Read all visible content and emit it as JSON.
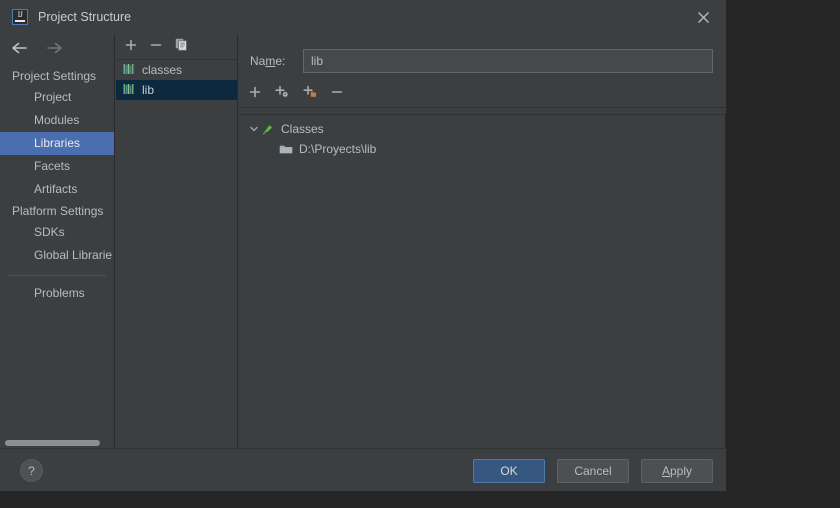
{
  "window": {
    "title": "Project Structure",
    "app_icon": "intellij-idea-logo",
    "close_icon": "close-icon"
  },
  "navigation": {
    "back_icon": "arrow-left-icon",
    "forward_icon": "arrow-right-icon"
  },
  "sidebar": {
    "groups": [
      {
        "header": "Project Settings",
        "items": [
          {
            "label": "Project",
            "selected": false
          },
          {
            "label": "Modules",
            "selected": false
          },
          {
            "label": "Libraries",
            "selected": true
          },
          {
            "label": "Facets",
            "selected": false
          },
          {
            "label": "Artifacts",
            "selected": false
          }
        ]
      },
      {
        "header": "Platform Settings",
        "items": [
          {
            "label": "SDKs",
            "selected": false
          },
          {
            "label": "Global Librarie",
            "selected": false
          }
        ]
      }
    ],
    "extra": [
      {
        "label": "Problems",
        "selected": false
      }
    ]
  },
  "library_panel": {
    "toolbar": [
      {
        "name": "add-library-button",
        "glyph": "+"
      },
      {
        "name": "remove-library-button",
        "glyph": "−"
      },
      {
        "name": "copy-library-button",
        "glyph": "copy-icon"
      }
    ],
    "items": [
      {
        "label": "classes",
        "icon": "library-icon",
        "selected": false
      },
      {
        "label": "lib",
        "icon": "library-icon",
        "selected": true
      }
    ]
  },
  "detail": {
    "name_label_pre": "Na",
    "name_label_mnemonic": "m",
    "name_label_post": "e:",
    "name_value": "lib",
    "name_placeholder": "",
    "toolbar": [
      {
        "name": "add-root-button",
        "glyph": "+"
      },
      {
        "name": "add-from-maven-button",
        "glyph": "+◌"
      },
      {
        "name": "add-from-directory-button",
        "glyph": "+■"
      },
      {
        "name": "remove-root-button",
        "glyph": "−"
      }
    ],
    "tree": [
      {
        "label": "Classes",
        "icon": "classes-root-icon",
        "expanded": true,
        "level": 0,
        "chevron": "chevron-down-icon"
      },
      {
        "label": "D:\\Proyects\\lib",
        "icon": "folder-icon",
        "level": 1
      }
    ]
  },
  "footer": {
    "help_label": "?",
    "buttons": [
      {
        "name": "ok-button",
        "label": "OK",
        "primary": true,
        "mnemonic": ""
      },
      {
        "name": "cancel-button",
        "label": "Cancel",
        "primary": false,
        "mnemonic": ""
      },
      {
        "name": "apply-button",
        "label": "Apply",
        "primary": false,
        "mnemonic": "A"
      }
    ],
    "apply_pre": "",
    "apply_mnemonic": "A",
    "apply_post": "pply"
  },
  "colors": {
    "window_bg": "#3c3f41",
    "desktop_bg": "#262626",
    "sidebar_selection": "#4b6eaf",
    "list_selection": "#0d293f",
    "primary_button": "#365880",
    "text": "#bbbbbb"
  }
}
